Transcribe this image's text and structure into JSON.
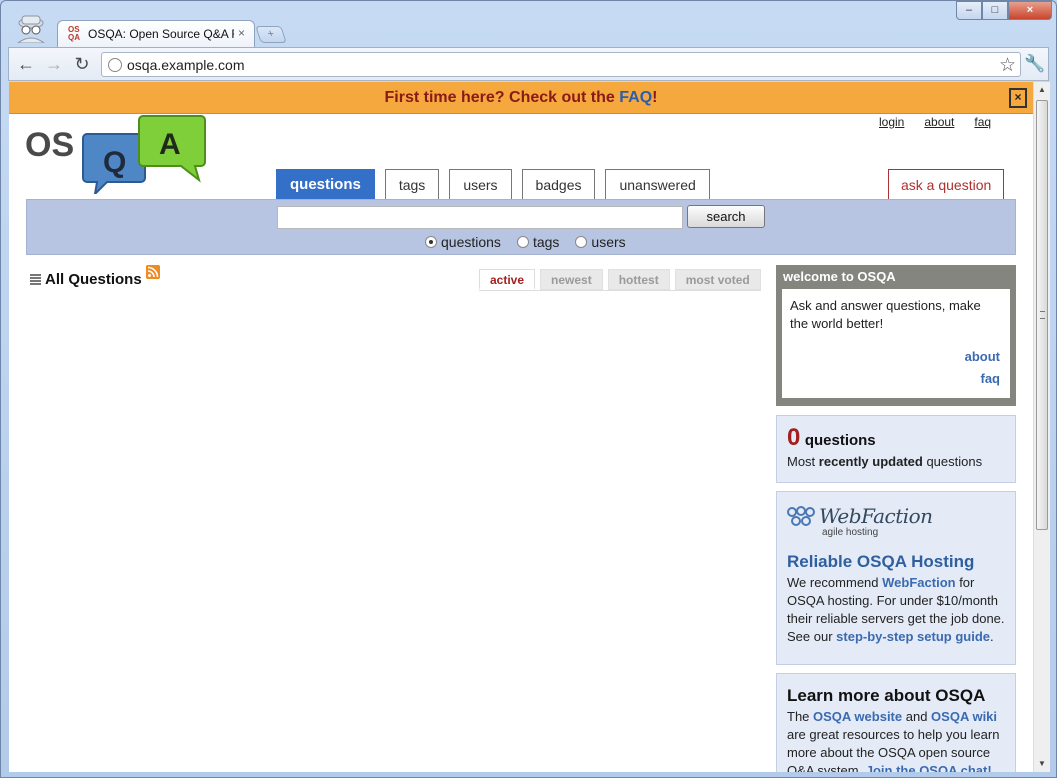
{
  "browser": {
    "tab_title": "OSQA: Open Source Q&A F",
    "tab_favicon": "OS QA",
    "tab_close": "×",
    "new_tab": "+",
    "url": "osqa.example.com",
    "window_buttons": {
      "minimize": "–",
      "maximize": "□",
      "close": "×"
    }
  },
  "notification": {
    "text_before": "First time here? Check out the ",
    "link": "FAQ",
    "text_after": "!",
    "close": "×"
  },
  "logo": {
    "letters_os": "OS",
    "letter_q": "Q",
    "letter_a": "A"
  },
  "top_links": [
    "login",
    "about",
    "faq"
  ],
  "nav": {
    "tabs": [
      "questions",
      "tags",
      "users",
      "badges",
      "unanswered"
    ],
    "ask": "ask a question"
  },
  "search": {
    "value": "",
    "button": "search",
    "options": [
      "questions",
      "tags",
      "users"
    ],
    "selected": "questions"
  },
  "main": {
    "title": "All Questions",
    "sort_tabs": [
      "active",
      "newest",
      "hottest",
      "most voted"
    ],
    "active_sort": "active"
  },
  "sidebar": {
    "welcome": {
      "title": "welcome to OSQA",
      "text": "Ask and answer questions, make the world better!",
      "about": "about",
      "faq": "faq"
    },
    "count": {
      "number": "0",
      "label": "questions",
      "sub_prefix": "Most ",
      "sub_bold": "recently updated",
      "sub_suffix": " questions"
    },
    "hosting": {
      "logo_name": "WebFaction",
      "logo_tag": "agile hosting",
      "title": "Reliable OSQA Hosting",
      "t1": "We recommend ",
      "link1": "WebFaction",
      "t2": " for OSQA hosting. For under $10/month their reliable servers get the job done. See our ",
      "link2": "step-by-step setup guide",
      "t3": "."
    },
    "learn": {
      "title": "Learn more about OSQA",
      "t1": "The ",
      "link1": "OSQA website",
      "t2": " and ",
      "link2": "OSQA wiki",
      "t3": " are great resources to help you learn more about the OSQA open source Q&A system. ",
      "link3": "Join the OSQA chat!"
    }
  },
  "colors": {
    "notify_bg": "#f4a83d",
    "nav_active": "#3470c7",
    "search_bg": "#b8c5e2",
    "accent_red": "#a31f1f",
    "link_blue": "#3a6ab0"
  }
}
